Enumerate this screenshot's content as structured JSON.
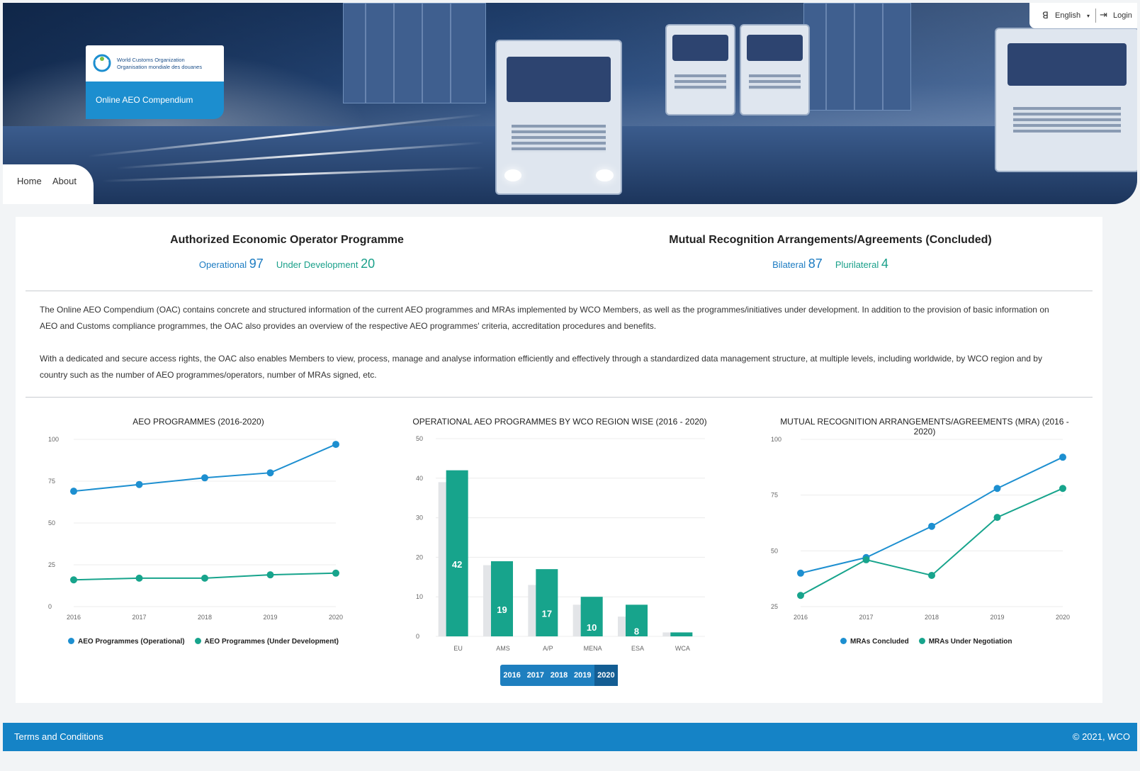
{
  "header": {
    "org_name_en": "World Customs Organization",
    "org_name_fr": "Organisation mondiale des douanes",
    "app_title": "Online AEO Compendium",
    "language": "English",
    "login": "Login",
    "nav": [
      "Home",
      "About"
    ]
  },
  "stats": {
    "aeo": {
      "title": "Authorized Economic Operator Programme",
      "operational_label": "Operational",
      "operational_value": "97",
      "under_dev_label": "Under Development",
      "under_dev_value": "20"
    },
    "mra": {
      "title": "Mutual Recognition Arrangements/Agreements (Concluded)",
      "bilateral_label": "Bilateral",
      "bilateral_value": "87",
      "plurilateral_label": "Plurilateral",
      "plurilateral_value": "4"
    }
  },
  "description": {
    "p1": "The Online AEO Compendium (OAC) contains concrete and structured information of the current AEO programmes and MRAs implemented by WCO Members, as well as the programmes/initiatives under development. In addition to the provision of basic information on AEO and Customs compliance programmes, the OAC also provides an overview of the respective AEO programmes' criteria, accreditation procedures and benefits.",
    "p2": "With a dedicated and secure access rights, the OAC also enables Members to view, process, manage and analyse information efficiently and effectively through a standardized data management structure, at multiple levels, including worldwide, by WCO region and by country such as the number of AEO programmes/operators, number of MRAs signed, etc."
  },
  "colors": {
    "blue": "#1d8fd0",
    "teal": "#17a48c",
    "grey_bar": "#e3e5e8",
    "footer": "#1583c6"
  },
  "chart_data": [
    {
      "type": "line",
      "title": "AEO PROGRAMMES (2016-2020)",
      "x": [
        "2016",
        "2017",
        "2018",
        "2019",
        "2020"
      ],
      "ylim": [
        0,
        100
      ],
      "yticks": [
        0,
        25,
        50,
        75,
        100
      ],
      "series": [
        {
          "name": "AEO Programmes (Operational)",
          "color": "#1d8fd0",
          "values": [
            69,
            73,
            77,
            80,
            97
          ]
        },
        {
          "name": "AEO Programmes (Under Development)",
          "color": "#17a48c",
          "values": [
            16,
            17,
            17,
            19,
            20
          ]
        }
      ],
      "legend": "bottom"
    },
    {
      "type": "bar",
      "title": "OPERATIONAL AEO PROGRAMMES BY WCO REGION WISE (2016 - 2020)",
      "categories": [
        "EU",
        "AMS",
        "A/P",
        "MENA",
        "ESA",
        "WCA"
      ],
      "ylim": [
        0,
        50
      ],
      "yticks": [
        0,
        10,
        20,
        30,
        40,
        50
      ],
      "series": [
        {
          "color": "#e3e5e8",
          "values": [
            39,
            18,
            13,
            8,
            5,
            1
          ]
        },
        {
          "color": "#17a48c",
          "values": [
            42,
            19,
            17,
            10,
            8,
            1
          ]
        }
      ],
      "data_labels": [
        "42",
        "19",
        "17",
        "10",
        "8",
        ""
      ],
      "year_tabs": [
        "2016",
        "2017",
        "2018",
        "2019",
        "2020"
      ],
      "active_year": "2020"
    },
    {
      "type": "line",
      "title": "MUTUAL RECOGNITION ARRANGEMENTS/AGREEMENTS (MRA) (2016 - 2020)",
      "x": [
        "2016",
        "2017",
        "2018",
        "2019",
        "2020"
      ],
      "ylim": [
        25,
        100
      ],
      "yticks": [
        25,
        50,
        75,
        100
      ],
      "series": [
        {
          "name": "MRAs Concluded",
          "color": "#1d8fd0",
          "values": [
            40,
            47,
            61,
            78,
            92
          ]
        },
        {
          "name": "MRAs Under Negotiation",
          "color": "#17a48c",
          "values": [
            30,
            46,
            39,
            65,
            78
          ]
        }
      ],
      "legend": "bottom"
    }
  ],
  "footer": {
    "terms": "Terms and Conditions",
    "copyright": "© 2021, WCO"
  }
}
